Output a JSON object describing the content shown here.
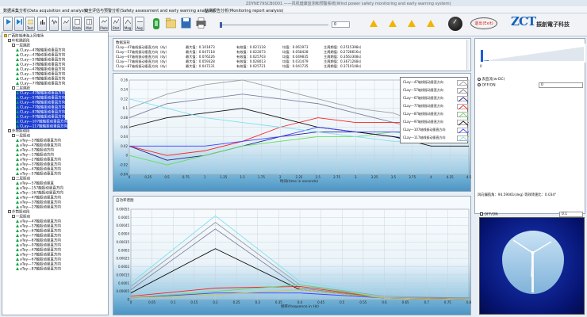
{
  "window": {
    "title": "ZDYNE79SCB0001 ——风机健康监测和预警系统(Wind power safety monitoring and early warning system)"
  },
  "menu": [
    "数据采集分析(Data acquisition and analysis)",
    "安全评估与预警分析(Safety assessment and early warning analysis)",
    "监测报告分析(Monitoring report analysis)"
  ],
  "toolbar": {
    "buttons": [
      "start",
      "step",
      "Test",
      "chart",
      "wave",
      "signal",
      "Data",
      "Mxt",
      "Plots",
      "Stat",
      "Mag",
      "Avg"
    ],
    "value": "0",
    "exit_label": "退出(Exit)"
  },
  "brand": {
    "logo_mark": "ZCT",
    "company": "振創電子科技"
  },
  "tree": {
    "root": "广西防城港海上风电场",
    "groups": [
      {
        "label": "叶轮跳跃段",
        "children": [
          {
            "label": "一层跳跃",
            "leaves": [
              "CLay—47触轴振动垂直方向",
              "CLay—47触动振动垂直方向",
              "CLay—57触轴振动垂直方向",
              "CLay—37触轴振动垂直方向",
              "CLay—47触轴振动垂直方向",
              "CLay—57触轴振动垂直方向",
              "CLay—67触轴振动垂直方向",
              "CLay—77触轴振动垂直方向"
            ]
          },
          {
            "label": "二层跳跃",
            "leaves": [
              "CLay—47触轴振动垂直方向",
              "CLay—57触轴振动垂直方向",
              "CLay—67触轴振动垂直方向",
              "CLay—77触轴振动垂直方向",
              "CLay—87触轴振动垂直方向",
              "CLay—97触轴振动垂直方向",
              "CLay—107触轴振动垂直方向",
              "CLay—117触轴振动垂直方向"
            ]
          }
        ]
      },
      {
        "label": "外塔振动段",
        "children": [
          {
            "label": "一层振动",
            "leaves": [
              "aTay—37触振动垂直方向",
              "aTay—47触振动垂直方向",
              "aTay—57触振动方向",
              "aTay—17触振动方向",
              "aTay—27触振动垂直方向",
              "aTay—37触振动垂直方向",
              "aTay—47触振动垂直方向",
              "aTay—57触振动垂直方向"
            ]
          },
          {
            "label": "二层振动",
            "leaves": [
              "aTay—57触振动竖直",
              "aTay—157触振动竖直方向",
              "aTay—167触振动竖直方向",
              "aTay—47触振动竖直方向",
              "aTay—37触振动竖直方向",
              "aTay—27触振动竖直方向"
            ]
          }
        ]
      },
      {
        "label": "外筒振动段",
        "children": [
          {
            "label": "一层振动",
            "leaves": [
              "aTay—47触振动竖直方向",
              "aTay—57触振动竖直方向",
              "aTay—67触振动竖直方向",
              "aTay—77触振动竖直方向",
              "aTay—87触振动竖直方向",
              "aTay—97触振动竖直方向",
              "aTay—47触振动竖直方向",
              "aTay—57触振动竖直方向",
              "aTay—67触振动竖直方向",
              "aTay—77触振动竖直方向",
              "aTay—87触振动竖直方向"
            ]
          }
        ]
      }
    ]
  },
  "info_panel": {
    "title": "数据波形",
    "rows": [
      [
        "CLay—47轴线振动垂直方向（dy）",
        "最大值：0.101873",
        "有效值：0.021118",
        "均值：0.061973",
        "主周期值：0.2515398s）"
      ],
      [
        "CLay—57轴线振动垂直方向（dy）",
        "最大值：0.047118",
        "有效值：0.022073",
        "均值：0.058428",
        "主周期值：0.2728616s）"
      ],
      [
        "CLay—67轴线振动垂直方向（dy）",
        "最大值：0.076226",
        "有效值：0.025703",
        "均值：0.049835",
        "主周期值：0.3563308s）"
      ],
      [
        "CLay—77轴线振动垂直方向（dy）",
        "最大值：0.059328",
        "有效值：0.028013",
        "均值：0.031479",
        "主周期值：0.3671268s）"
      ],
      [
        "CLay—87轴线振动垂直方向（dy）",
        "最大值：0.047231",
        "有效值：0.025721",
        "均值：0.041735",
        "主周期值：0.3710148s）"
      ]
    ]
  },
  "spectrum_panel": {
    "title": "自功率谱图"
  },
  "right_panel": {
    "slider_value": "0",
    "options": [
      "去直流(w-DC)",
      "OFF/ON"
    ],
    "option_value": "0",
    "status_text": "风向偏航角：94.59061(deg) 等效转速比：0.034°",
    "toggle_label": "OFF/ON",
    "toggle_value": "0.1"
  },
  "chart_data": [
    {
      "type": "line",
      "title": "",
      "xlabel": "时间(time in seconds)",
      "ylabel": "",
      "x": [
        0,
        0.5,
        1,
        1.5,
        2,
        2.5,
        3,
        3.5,
        4,
        4.5
      ],
      "xticks": [
        "0",
        "0.25",
        "0.5",
        "0.75",
        "1",
        "1.25",
        "1.5",
        "1.75",
        "2",
        "2.25",
        "2.5",
        "2.75",
        "3",
        "3.25",
        "3.5",
        "3.75",
        "4",
        "4.25",
        "4.5"
      ],
      "ylim": [
        -0.04,
        0.16
      ],
      "yticks": [
        "-0.04",
        "-0.02",
        "0",
        "0.02",
        "0.04",
        "0.06",
        "0.08",
        "0.1",
        "0.12",
        "0.14",
        "0.16"
      ],
      "grid": true,
      "legend": "top-right",
      "series": [
        {
          "name": "CLay—47轴线振动垂直方向",
          "color": "#a0a0a0",
          "values": [
            0.1,
            0.13,
            0.15,
            0.16,
            0.14,
            0.12,
            0.1,
            0.09,
            0.06,
            0.05
          ]
        },
        {
          "name": "CLay—57轴线振动垂直方向",
          "color": "#7f7f9f",
          "values": [
            0.08,
            0.11,
            0.12,
            0.13,
            0.12,
            0.11,
            0.09,
            0.07,
            0.05,
            0.04
          ]
        },
        {
          "name": "CLay—67轴线振动垂直方向",
          "color": "#1f1f8f",
          "values": [
            0.02,
            -0.01,
            0.0,
            0.02,
            0.04,
            0.05,
            0.05,
            0.04,
            0.03,
            0.03
          ]
        },
        {
          "name": "CLay—77轴线振动垂直方向",
          "color": "#ff2020",
          "values": [
            0.02,
            0.0,
            0.01,
            0.03,
            0.06,
            0.08,
            0.07,
            0.07,
            0.07,
            0.07
          ]
        },
        {
          "name": "CLay—87轴线振动垂直方向",
          "color": "#60e060",
          "values": [
            0.0,
            -0.02,
            0.0,
            0.02,
            0.03,
            0.04,
            0.04,
            0.05,
            0.04,
            0.04
          ]
        },
        {
          "name": "CLay—97轴线振动垂直方向",
          "color": "#111111",
          "values": [
            0.06,
            0.08,
            0.09,
            0.1,
            0.08,
            0.06,
            0.05,
            0.04,
            0.02,
            0.02
          ]
        },
        {
          "name": "CLay—107轴线振动垂直方向",
          "color": "#4040ff",
          "values": [
            0.02,
            0.02,
            0.02,
            0.03,
            0.04,
            0.06,
            0.05,
            0.05,
            0.05,
            0.05
          ]
        },
        {
          "name": "CLay—117轴线振动垂直方向",
          "color": "#7ee0ee",
          "values": [
            0.12,
            0.1,
            0.08,
            0.07,
            0.06,
            0.05,
            0.04,
            0.03,
            0.03,
            0.03
          ]
        }
      ]
    },
    {
      "type": "line",
      "title": "",
      "xlabel": "频率(frequence in Hz)",
      "ylabel": "",
      "x": [
        0,
        0.2,
        0.4,
        0.6,
        0.8
      ],
      "xticks": [
        "0",
        "0.05",
        "0.1",
        "0.15",
        "0.2",
        "0.25",
        "0.3",
        "0.35",
        "0.4",
        "0.45",
        "0.5",
        "0.55",
        "0.6",
        "0.65",
        "0.7",
        "0.75",
        "0.8"
      ],
      "ylim": [
        0,
        0.00055
      ],
      "yticks": [
        "0",
        "0.00005",
        "0.0001",
        "0.00015",
        "0.0002",
        "0.00025",
        "0.0003",
        "0.00035",
        "0.0004",
        "0.00045",
        "0.0005",
        "0.00055"
      ],
      "grid": true,
      "series": [
        {
          "name": "CLay—47轴线振动垂直方向",
          "color": "#7ee0ee",
          "values": [
            0.0001,
            0.00051,
            0.00011,
            2e-05,
            1e-05
          ]
        },
        {
          "name": "CLay—57轴线振动垂直方向",
          "color": "#a0a0a0",
          "values": [
            8e-05,
            0.00047,
            9e-05,
            2e-05,
            1e-05
          ]
        },
        {
          "name": "CLay—67轴线振动垂直方向",
          "color": "#7f7f9f",
          "values": [
            6e-05,
            0.00043,
            7e-05,
            1e-05,
            1e-05
          ]
        },
        {
          "name": "CLay—77轴线振动垂直方向",
          "color": "#111111",
          "values": [
            4e-05,
            0.00031,
            6e-05,
            1e-05,
            0.0
          ]
        },
        {
          "name": "CLay—87轴线振动垂直方向",
          "color": "#ff2020",
          "values": [
            2e-05,
            7e-05,
            8e-05,
            1e-05,
            0.0
          ]
        },
        {
          "name": "CLay—97轴线振动垂直方向",
          "color": "#60e060",
          "values": [
            1e-05,
            5e-05,
            9e-05,
            1e-05,
            0.0
          ]
        },
        {
          "name": "CLay—107轴线振动垂直方向",
          "color": "#4040ff",
          "values": [
            1e-05,
            4e-05,
            4e-05,
            1e-05,
            0.0
          ]
        },
        {
          "name": "CLay—117轴线振动垂直方向",
          "color": "#d8c040",
          "values": [
            1e-05,
            3e-05,
            6e-05,
            1e-05,
            0.0
          ]
        }
      ]
    }
  ]
}
